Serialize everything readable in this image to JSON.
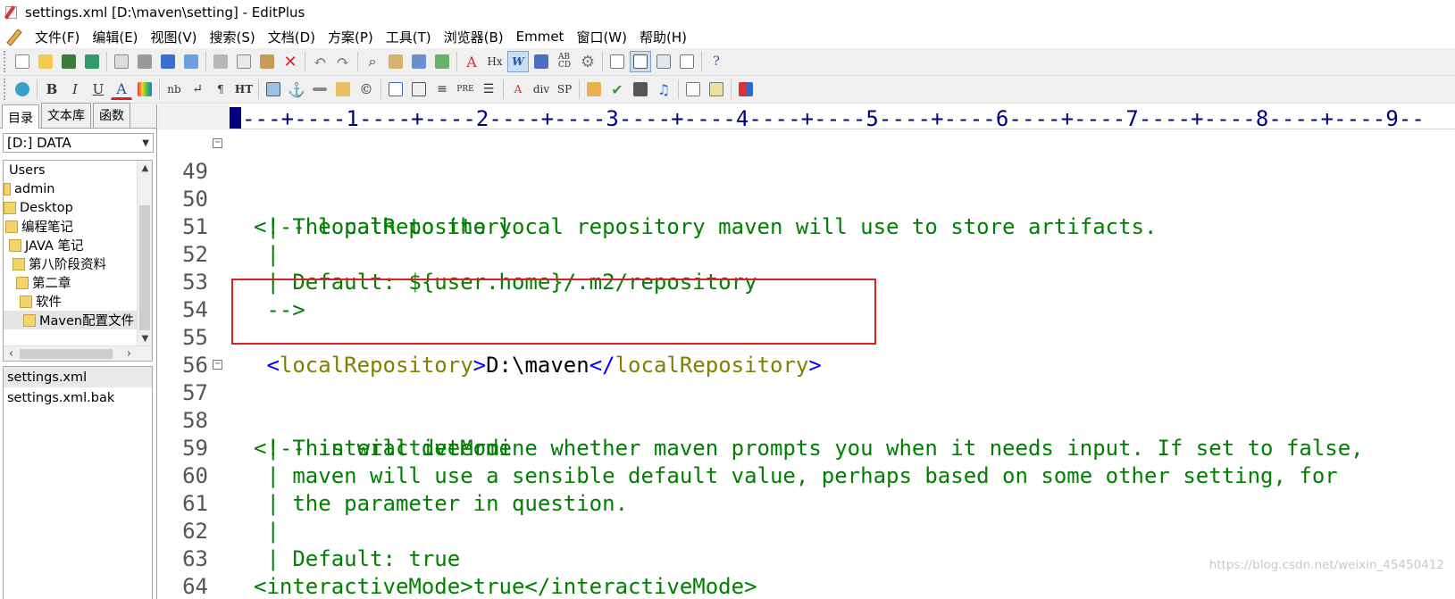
{
  "window": {
    "title": "settings.xml [D:\\maven\\setting] - EditPlus"
  },
  "menu": {
    "items": [
      "文件(F)",
      "编辑(E)",
      "视图(V)",
      "搜索(S)",
      "文档(D)",
      "方案(P)",
      "工具(T)",
      "浏览器(B)",
      "Emmet",
      "窗口(W)",
      "帮助(H)"
    ]
  },
  "toolbar2": {
    "labels": [
      "B",
      "I",
      "U",
      "A",
      "nb",
      "¶",
      "HT",
      "PRE",
      "A",
      "div",
      "SP"
    ]
  },
  "sidebar": {
    "tabs": [
      "目录",
      "文本库",
      "函数"
    ],
    "drive": "[D:] DATA",
    "tree": [
      "Users",
      "admin",
      "Desktop",
      "编程笔记",
      "JAVA 笔记",
      "第八阶段资料",
      "第二章",
      "软件",
      "Maven配置文件"
    ],
    "files": [
      "settings.xml",
      "settings.xml.bak"
    ]
  },
  "ruler": {
    "text": "---+----1----+----2----+----3----+----4----+----5----+----6----+----7----+----8----+----9--"
  },
  "editor": {
    "lines": [
      {
        "num": "49",
        "fold": true,
        "text": "<!-- localRepository"
      },
      {
        "num": "50",
        "text": " | The path to the local repository maven will use to store artifacts."
      },
      {
        "num": "51",
        "text": " |"
      },
      {
        "num": "52",
        "text": " | Default: ${user.home}/.m2/repository"
      },
      {
        "num": "53",
        "text": " -->"
      },
      {
        "num": "54",
        "text": ""
      },
      {
        "num": "55",
        "open": " <",
        "tag_open": "localRepository",
        "mid": ">",
        "value": "D:\\maven",
        "close": "</",
        "tag_close": "localRepository",
        "end": ">"
      },
      {
        "num": "56",
        "text": ""
      },
      {
        "num": "57",
        "fold": true,
        "text": "<!-- interactiveMode"
      },
      {
        "num": "58",
        "text": " | This will determine whether maven prompts you when it needs input. If set to false,"
      },
      {
        "num": "59",
        "text": " | maven will use a sensible default value, perhaps based on some other setting, for"
      },
      {
        "num": "60",
        "text": " | the parameter in question."
      },
      {
        "num": "61",
        "text": " |"
      },
      {
        "num": "62",
        "text": " | Default: true"
      },
      {
        "num": "63",
        "text": "<interactiveMode>true</interactiveMode>"
      },
      {
        "num": "64",
        "text": " -->"
      }
    ]
  },
  "watermark": "https://blog.csdn.net/weixin_45450412",
  "colors": {
    "comment": "#008000",
    "bracket": "#0000ff",
    "tag": "#808000",
    "highlight": "#e02020",
    "ruler": "#000080"
  }
}
